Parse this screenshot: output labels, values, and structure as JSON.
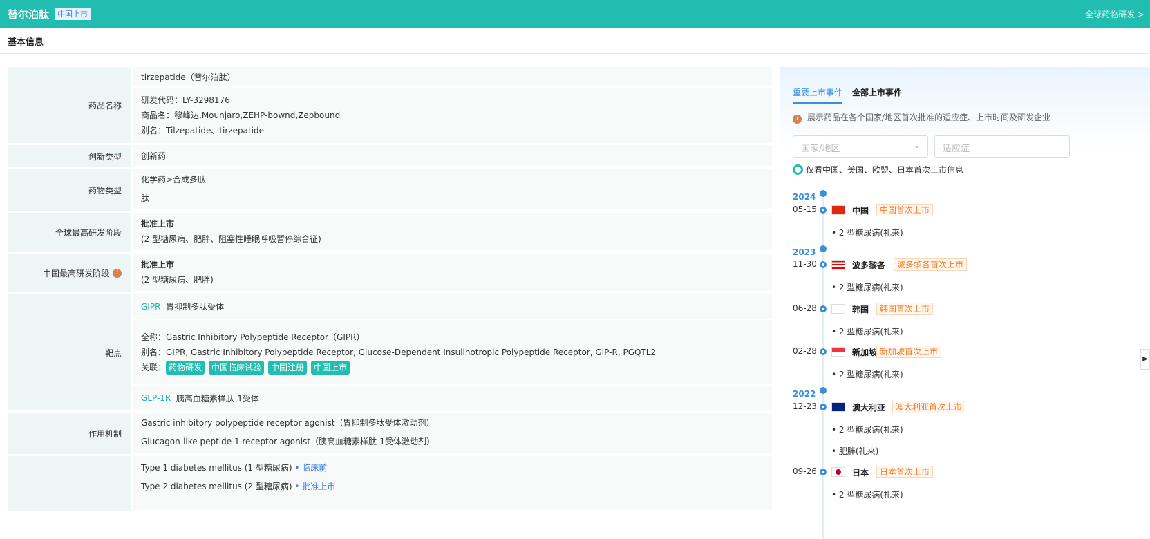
{
  "header": {
    "title": "替尔泊肽",
    "badge": "中国上市",
    "link": "全球药物研发 >"
  },
  "section": "基本信息",
  "fields": {
    "name_label": "药品名称",
    "name_main": "tirzepatide（替尔泊肽）",
    "code": "研发代码：LY-3298176",
    "trade": "商品名：穆峰达,Mounjaro,ZEHP-bownd,Zepbound",
    "alias": "别名：Tilzepatide、tirzepatide",
    "innov_label": "创新类型",
    "innov": "创新药",
    "type_label": "药物类型",
    "type1": "化学药>合成多肽",
    "type2": "肽",
    "global_label": "全球最高研发阶段",
    "global_stage": "批准上市",
    "global_ind": "(2 型糖尿病、肥胖、阻塞性睡眠呼吸暂停综合征)",
    "china_label": "中国最高研发阶段",
    "china_stage": "批准上市",
    "china_ind": "(2 型糖尿病、肥胖)",
    "target_label": "靶点",
    "t1_code": "GIPR",
    "t1_name": "胃抑制多肽受体",
    "t1_full": "全称：Gastric Inhibitory Polypeptide Receptor（GIPR）",
    "t1_alias": "别名：GIPR, Gastric Inhibitory Polypeptide Receptor, Glucose-Dependent Insulinotropic Polypeptide Receptor, GIP-R, PGQTL2",
    "rel_label": "关联：",
    "tags": [
      "药物研发",
      "中国临床试验",
      "中国注册",
      "中国上市"
    ],
    "t2_code": "GLP-1R",
    "t2_name": "胰高血糖素样肽-1受体",
    "moa_label": "作用机制",
    "moa1": "Gastric inhibitory polypeptide receptor agonist（胃抑制多肽受体激动剂）",
    "moa2": "Glucagon-like peptide 1 receptor agonist（胰高血糖素样肽-1受体激动剂）",
    "ind1": "Type 1 diabetes mellitus (1 型糖尿病)",
    "ind1_stage": "• 临床前",
    "ind2": "Type 2 diabetes mellitus (2 型糖尿病)",
    "ind2_stage": "• 批准上市"
  },
  "panel": {
    "tab1": "重要上市事件",
    "tab2": "全部上市事件",
    "note": "展示药品在各个国家/地区首次批准的适应症、上市时间及研发企业",
    "country_ph": "国家/地区",
    "ind_ph": "适应症",
    "radio": "仅看中国、美国、欧盟、日本首次上市信息",
    "years": [
      "2024",
      "2023",
      "2022"
    ],
    "events": [
      {
        "date": "05-15",
        "country": "中国",
        "badge": "中国首次上市",
        "items": [
          "• 2 型糖尿病(礼来)"
        ]
      },
      {
        "date": "11-30",
        "country": "波多黎各",
        "badge": "波多黎各首次上市",
        "items": [
          "• 2 型糖尿病(礼来)"
        ]
      },
      {
        "date": "06-28",
        "country": "韩国",
        "badge": "韩国首次上市",
        "items": [
          "• 2 型糖尿病(礼来)"
        ]
      },
      {
        "date": "02-28",
        "country": "新加坡",
        "badge": "新加坡首次上市",
        "items": [
          "• 2 型糖尿病(礼来)"
        ]
      },
      {
        "date": "12-23",
        "country": "澳大利亚",
        "badge": "澳大利亚首次上市",
        "items": [
          "• 2 型糖尿病(礼来)",
          "• 肥胖(礼来)"
        ]
      },
      {
        "date": "09-26",
        "country": "日本",
        "badge": "日本首次上市",
        "items": [
          "• 2 型糖尿病(礼来)"
        ]
      }
    ]
  }
}
